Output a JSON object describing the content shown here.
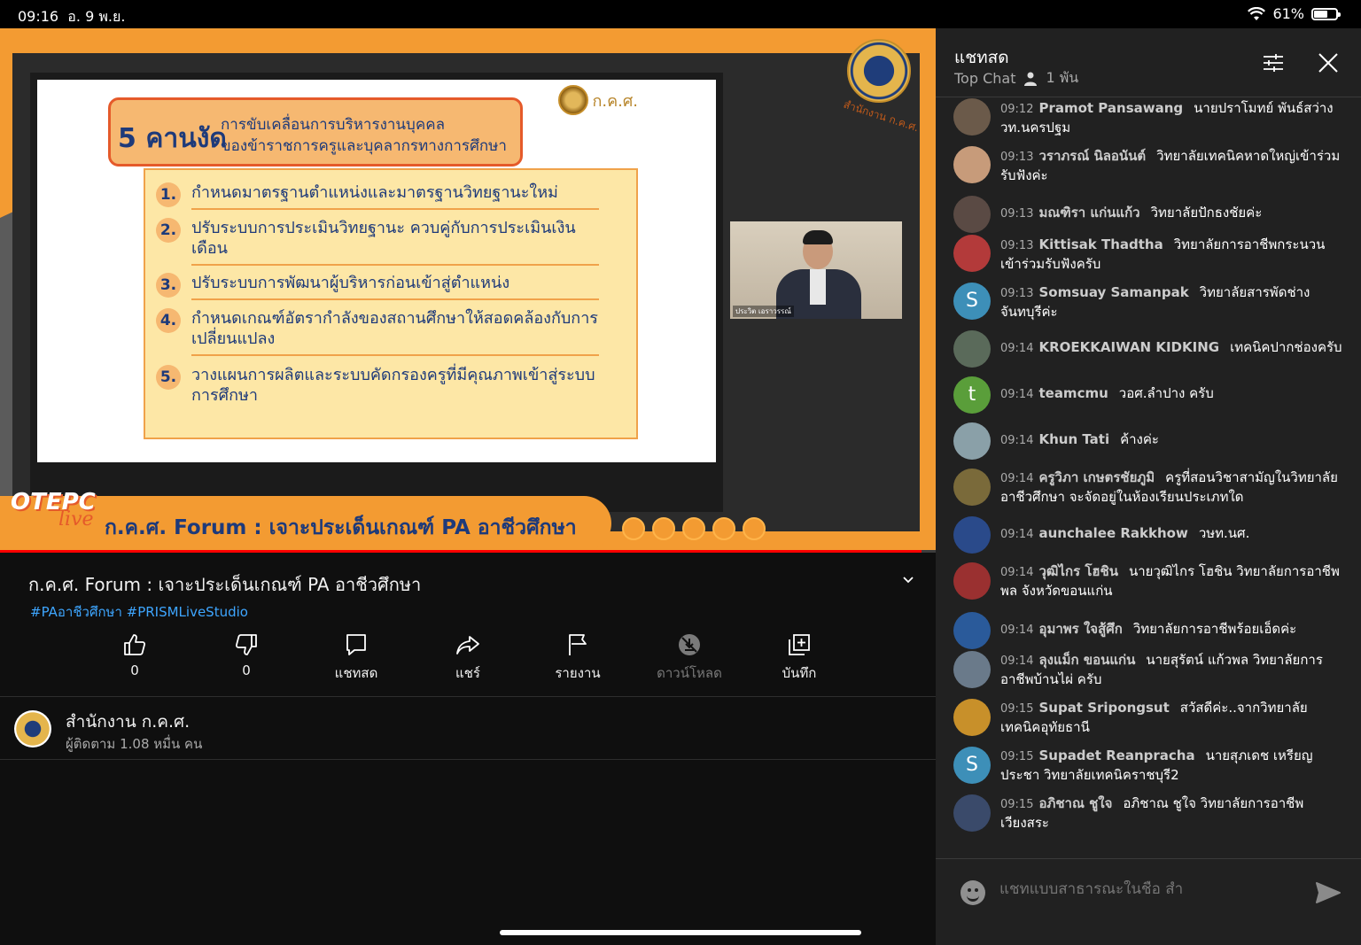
{
  "status_bar": {
    "time": "09:16",
    "date": "อ. 9 พ.ย.",
    "battery": "61%",
    "battery_level": 0.61
  },
  "video": {
    "slide": {
      "title_big": "5 คานงัด",
      "title_line1": "การขับเคลื่อนการบริหารงานบุคคล",
      "title_line2": "ของข้าราชการครูและบุคลากรทางการศึกษา",
      "logo_text": "ก.ค.ศ.",
      "items": [
        {
          "num": "1.",
          "text": "กำหนดมาตรฐานตำแหน่งและมาตรฐานวิทยฐานะใหม่"
        },
        {
          "num": "2.",
          "text": "ปรับระบบการประเมินวิทยฐานะ ควบคู่กับการประเมินเงินเดือน"
        },
        {
          "num": "3.",
          "text": "ปรับระบบการพัฒนาผู้บริหารก่อนเข้าสู่ตำแหน่ง"
        },
        {
          "num": "4.",
          "text": "กำหนดเกณฑ์อัตรากำลังของสถานศึกษาให้สอดคล้องกับการเปลี่ยนแปลง"
        },
        {
          "num": "5.",
          "text": "วางแผนการผลิตและระบบคัดกรองครูที่มีคุณภาพเข้าสู่ระบบการศึกษา"
        }
      ]
    },
    "logo_caption": "สำนักงาน ก.ค.ศ.",
    "pip_label": "ประวิต เอราวรรณ์",
    "tepc": "OTEPC",
    "tepc_live": "live",
    "banner": "ก.ค.ศ. Forum : เจาะประเด็นเกณฑ์ PA อาชีวศึกษา",
    "progress": 0.985
  },
  "info": {
    "title": "ก.ค.ศ. Forum : เจาะประเด็นเกณฑ์ PA อาชีวศึกษา",
    "hashtags": "#PAอาชีวศึกษา #PRISMLiveStudio"
  },
  "actions": [
    {
      "name": "like",
      "label": "0"
    },
    {
      "name": "dislike",
      "label": "0"
    },
    {
      "name": "live-chat",
      "label": "แชทสด"
    },
    {
      "name": "share",
      "label": "แชร์"
    },
    {
      "name": "report",
      "label": "รายงาน"
    },
    {
      "name": "download",
      "label": "ดาวน์โหลด"
    },
    {
      "name": "save",
      "label": "บันทึก"
    }
  ],
  "channel": {
    "name": "สำนักงาน ก.ค.ศ.",
    "subscribers": "ผู้ติดตาม 1.08 หมื่น คน"
  },
  "chat": {
    "title": "แชทสด",
    "mode": "Top Chat",
    "viewers": "1 พัน",
    "input_placeholder": "แชทแบบสาธารณะในชื่อ สำ",
    "messages": [
      {
        "time": "09:12",
        "author": "Pramot Pansawang",
        "text": "นายปราโมทย์ พันธ์สว่าง วท.นครปฐม",
        "avatar_color": "#6b5a4a"
      },
      {
        "time": "09:13",
        "author": "วราภรณ์ นิลอนันต์",
        "text": "วิทยาลัยเทคนิคหาดใหญ่เข้าร่วมรับฟังค่ะ",
        "avatar_color": "#c79b7a"
      },
      {
        "time": "09:13",
        "author": "มณฑิรา แก่นแก้ว",
        "text": "วิทยาลัยปักธงชัยค่ะ",
        "avatar_color": "#5a4a44"
      },
      {
        "time": "09:13",
        "author": "Kittisak Thadtha",
        "text": "วิทยาลัยการอาชีพกระนวน เข้าร่วมรับฟังครับ",
        "avatar_color": "#b33a3a"
      },
      {
        "time": "09:13",
        "author": "Somsuay Samanpak",
        "text": "วิทยาลัยสารพัดช่างจันทบุรีค่ะ",
        "avatar_color": "#3d8fb8",
        "letter": "S"
      },
      {
        "time": "09:14",
        "author": "KROEKKAIWAN KIDKING",
        "text": "เทคนิคปากช่องครับ",
        "avatar_color": "#5a6a5a"
      },
      {
        "time": "09:14",
        "author": "teamcmu",
        "text": "วอศ.ลำปาง ครับ",
        "avatar_color": "#5a9e3a",
        "letter": "t"
      },
      {
        "time": "09:14",
        "author": "Khun Tati",
        "text": "ค้างค่ะ",
        "avatar_color": "#8aa0a8"
      },
      {
        "time": "09:14",
        "author": "ครูวิภา เกษตรชัยภูมิ",
        "text": "ครูที่สอนวิชาสามัญในวิทยาลัยอาชีวศึกษา จะจัดอยู่ในห้องเรียนประเภทใด",
        "avatar_color": "#7a6a3a"
      },
      {
        "time": "09:14",
        "author": "aunchalee Rakkhow",
        "text": "วษท.นศ.",
        "avatar_color": "#2a4a8a"
      },
      {
        "time": "09:14",
        "author": "วุฒิไกร โฮชิน",
        "text": "นายวุฒิไกร โฮชิน วิทยาลัยการอาชีพพล จังหวัดขอนแก่น",
        "avatar_color": "#9a3030"
      },
      {
        "time": "09:14",
        "author": "อุมาพร ใจสู้ศึก",
        "text": "วิทยาลัยการอาชีพร้อยเอ็ดค่ะ",
        "avatar_color": "#2a5a9a"
      },
      {
        "time": "09:14",
        "author": "ลุงแม็ก ขอนแก่น",
        "text": "นายสุรัตน์ แก้วพล วิทยาลัยการอาชีพบ้านไผ่ ครับ",
        "avatar_color": "#6a7a8a"
      },
      {
        "time": "09:15",
        "author": "Supat Sripongsut",
        "text": "สวัสดีค่ะ..จากวิทยาลัยเทคนิคอุทัยธานี",
        "avatar_color": "#c8902a"
      },
      {
        "time": "09:15",
        "author": "Supadet Reanpracha",
        "text": "นายสุภเดช เหรียญประชา วิทยาลัยเทคนิคราชบุรี2",
        "avatar_color": "#3d8fb8",
        "letter": "S"
      },
      {
        "time": "09:15",
        "author": "อภิชาณ ชูใจ",
        "text": "อภิชาณ ชูใจ วิทยาลัยการอาชีพเวียงสระ",
        "avatar_color": "#3a4a6a"
      }
    ]
  },
  "colors": {
    "accent": "#f39b32",
    "link": "#3ea6ff",
    "slide_text": "#1e3a7a",
    "chat_bg": "#212121"
  }
}
